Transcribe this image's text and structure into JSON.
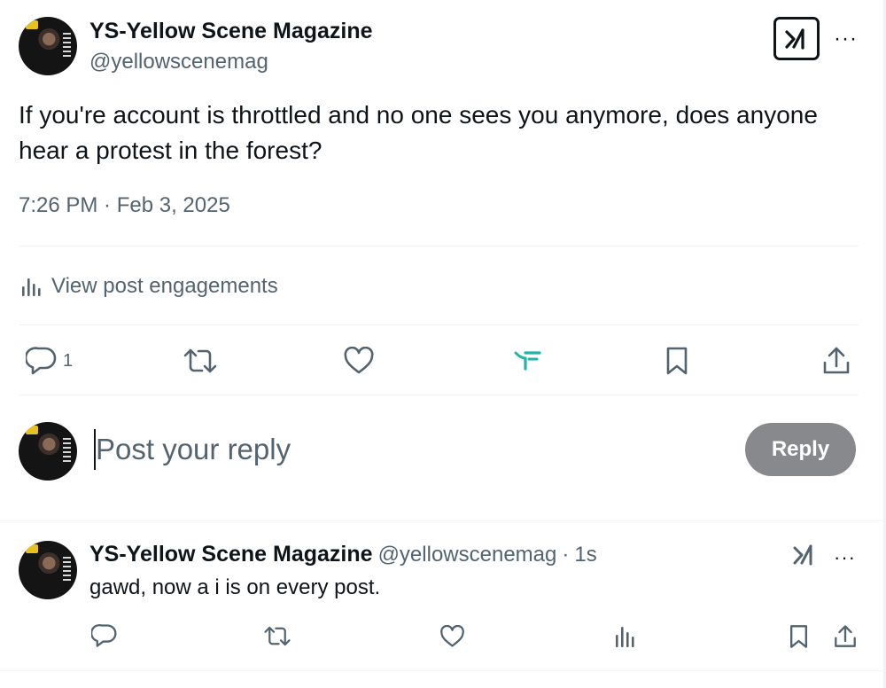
{
  "post": {
    "author_name": "YS-Yellow Scene Magazine",
    "author_handle": "@yellowscenemag",
    "text": "If you're account is throttled and no one sees you anymore, does anyone hear a protest in the forest?",
    "timestamp": "7:26 PM · Feb 3, 2025",
    "more_label": "···"
  },
  "engagements": {
    "label": "View post engagements",
    "icon": "analytics-icon"
  },
  "actions": {
    "reply_count": "1",
    "icons": [
      "reply-icon",
      "repost-icon",
      "like-icon",
      "grok-alt-icon",
      "bookmark-icon",
      "share-icon"
    ]
  },
  "composer": {
    "placeholder": "Post your reply",
    "button_label": "Reply"
  },
  "reply": {
    "author_name": "YS-Yellow Scene Magazine",
    "author_handle": "@yellowscenemag",
    "separator": "·",
    "time": "1s",
    "text": "gawd, now a i is on every post.",
    "more_label": "···"
  },
  "colors": {
    "text_primary": "#0f1419",
    "text_secondary": "#536471",
    "divider": "#eff3f4",
    "reply_button": "#87898c",
    "accent_teal": "#1fb5a8"
  }
}
